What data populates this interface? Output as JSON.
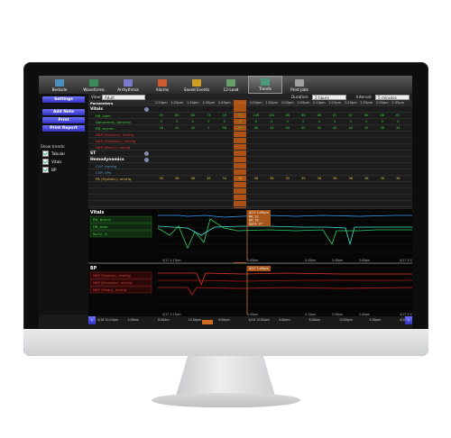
{
  "toolbar": {
    "items": [
      {
        "label": "Bedside",
        "icon": "bedside-icon",
        "color": "#4a8fc0"
      },
      {
        "label": "Waveforms",
        "icon": "waveforms-icon",
        "color": "#3a8a5a"
      },
      {
        "label": "Arrhythmia",
        "icon": "arrhythmia-icon",
        "color": "#7a7acc"
      },
      {
        "label": "Alarms",
        "icon": "alarms-icon",
        "color": "#d05a30"
      },
      {
        "label": "Saved Events",
        "icon": "saved-events-icon",
        "color": "#d0a020"
      },
      {
        "label": "12-Lead",
        "icon": "twelve-lead-icon",
        "color": "#6aa06a"
      },
      {
        "label": "Trends",
        "icon": "trends-icon",
        "color": "#4a9a7a"
      },
      {
        "label": "Print Jobs",
        "icon": "print-jobs-icon",
        "color": "#a0a0a0"
      }
    ],
    "active_index": 6
  },
  "sidebar": {
    "buttons": [
      "Settings",
      "Add Note",
      "Print",
      "Print Report"
    ],
    "show_trends_label": "Show trends:",
    "checks": [
      "Tabular",
      "Vitals",
      "BP"
    ]
  },
  "viewbar": {
    "view_label": "View:",
    "view_value": "Adult",
    "duration_label": "Duration:",
    "duration_value": "2 hours",
    "interval_label": "Interval:",
    "interval_value": "5 minutes"
  },
  "table": {
    "header": "Parameters",
    "times": [
      "1:20pm",
      "1:25pm",
      "1:30pm",
      "1:35pm",
      "1:40pm",
      "1:45pm",
      "1:50pm",
      "1:55pm",
      "2:00pm",
      "2:05pm",
      "2:10pm",
      "2:15pm",
      "2:20pm",
      "2:25pm",
      "2:30pm",
      "2:35pm"
    ],
    "sections": [
      {
        "title": "Vitals",
        "rows": [
          {
            "label": "HR, bpm",
            "color": "#3ecf3e",
            "values": [
              "59",
              "60",
              "60",
              "73",
              "59",
              "73",
              "146",
              "101",
              "68",
              "68",
              "66",
              "67",
              "67",
              "66",
              "68",
              "67"
            ]
          },
          {
            "label": "Abnormals, Abn/min",
            "color": "#3ecf3e",
            "values": [
              "0",
              "0",
              "0",
              "0",
              "0",
              "0",
              "0",
              "0",
              "0",
              "0",
              "0",
              "0",
              "0",
              "0",
              "0",
              "0"
            ]
          },
          {
            "label": "RR, br/min",
            "color": "#3ecf3e",
            "values": [
              "16",
              "40",
              "40",
              "0",
              "96",
              "29",
              "36",
              "43",
              "40",
              "40",
              "40",
              "40",
              "40",
              "35",
              "38",
              "34"
            ]
          },
          {
            "label": "NBP (Systolic), mmHg",
            "color": "#e03030",
            "values": [
              "",
              "",
              "",
              "",
              "",
              "",
              "",
              "",
              "",
              "",
              "",
              "",
              "",
              "",
              "",
              ""
            ]
          },
          {
            "label": "NBP (Diastolic), mmHg",
            "color": "#e03030",
            "values": [
              "",
              "",
              "",
              "",
              "",
              "",
              "",
              "",
              "",
              "",
              "",
              "",
              "",
              "",
              "",
              ""
            ]
          },
          {
            "label": "NBP (Mean), mmHg",
            "color": "#e03030",
            "values": [
              "",
              "",
              "",
              "",
              "",
              "",
              "",
              "",
              "",
              "",
              "",
              "",
              "",
              "",
              "",
              ""
            ]
          }
        ]
      },
      {
        "title": "ST",
        "rows": []
      },
      {
        "title": "Hemodynamics",
        "rows": [
          {
            "label": "CVP, mmHg",
            "color": "#5a9ad0",
            "values": [
              "",
              "",
              "",
              "",
              "",
              "",
              "",
              "",
              "",
              "",
              "",
              "",
              "",
              "",
              "",
              ""
            ]
          },
          {
            "label": "CVP, kPa",
            "color": "#5a9ad0",
            "values": [
              "",
              "",
              "",
              "",
              "",
              "",
              "",
              "",
              "",
              "",
              "",
              "",
              "",
              "",
              "",
              ""
            ]
          },
          {
            "label": "PA (Systolic), mmHg",
            "color": "#e0c040",
            "values": [
              "35",
              "36",
              "36",
              "36",
              "34",
              "36",
              "36",
              "36",
              "35",
              "35",
              "36",
              "36",
              "36",
              "36",
              "36",
              "36"
            ]
          }
        ]
      }
    ]
  },
  "vitals_plot": {
    "title": "Vitals",
    "legend": [
      "RR, br/min",
      "HR, bpm",
      "SpO2, %"
    ],
    "marker_label": "4/17 1:45pm",
    "marker_lines": [
      "RR: 22",
      "HR: 93",
      "SpO2: 97"
    ],
    "axis_ticks": [
      "4/17 1:17pm",
      "1:45pm",
      "2:15pm",
      "2:30pm",
      "2:45pm",
      "4/17 3:15pm"
    ]
  },
  "bp_plot": {
    "title": "BP",
    "legend": [
      "NBP (Systolic), mmHg",
      "NBP (Diastolic), mmHg",
      "NBP (Mean), mmHg"
    ],
    "marker_label": "4/17 1:45pm",
    "axis_ticks": [
      "4/17 1:17pm",
      "1:45pm",
      "2:15pm",
      "2:30pm",
      "2:45pm",
      "4/17 3:15pm"
    ]
  },
  "timeline": {
    "ticks": [
      "4/16 10:23pm",
      "4:00am",
      "8:00am",
      "12:00pm",
      "4:00pm",
      "4/18 12:00am",
      "4:00am",
      "8:00am",
      "12:00pm",
      "4:00pm",
      "4/18 8:00pm"
    ]
  }
}
